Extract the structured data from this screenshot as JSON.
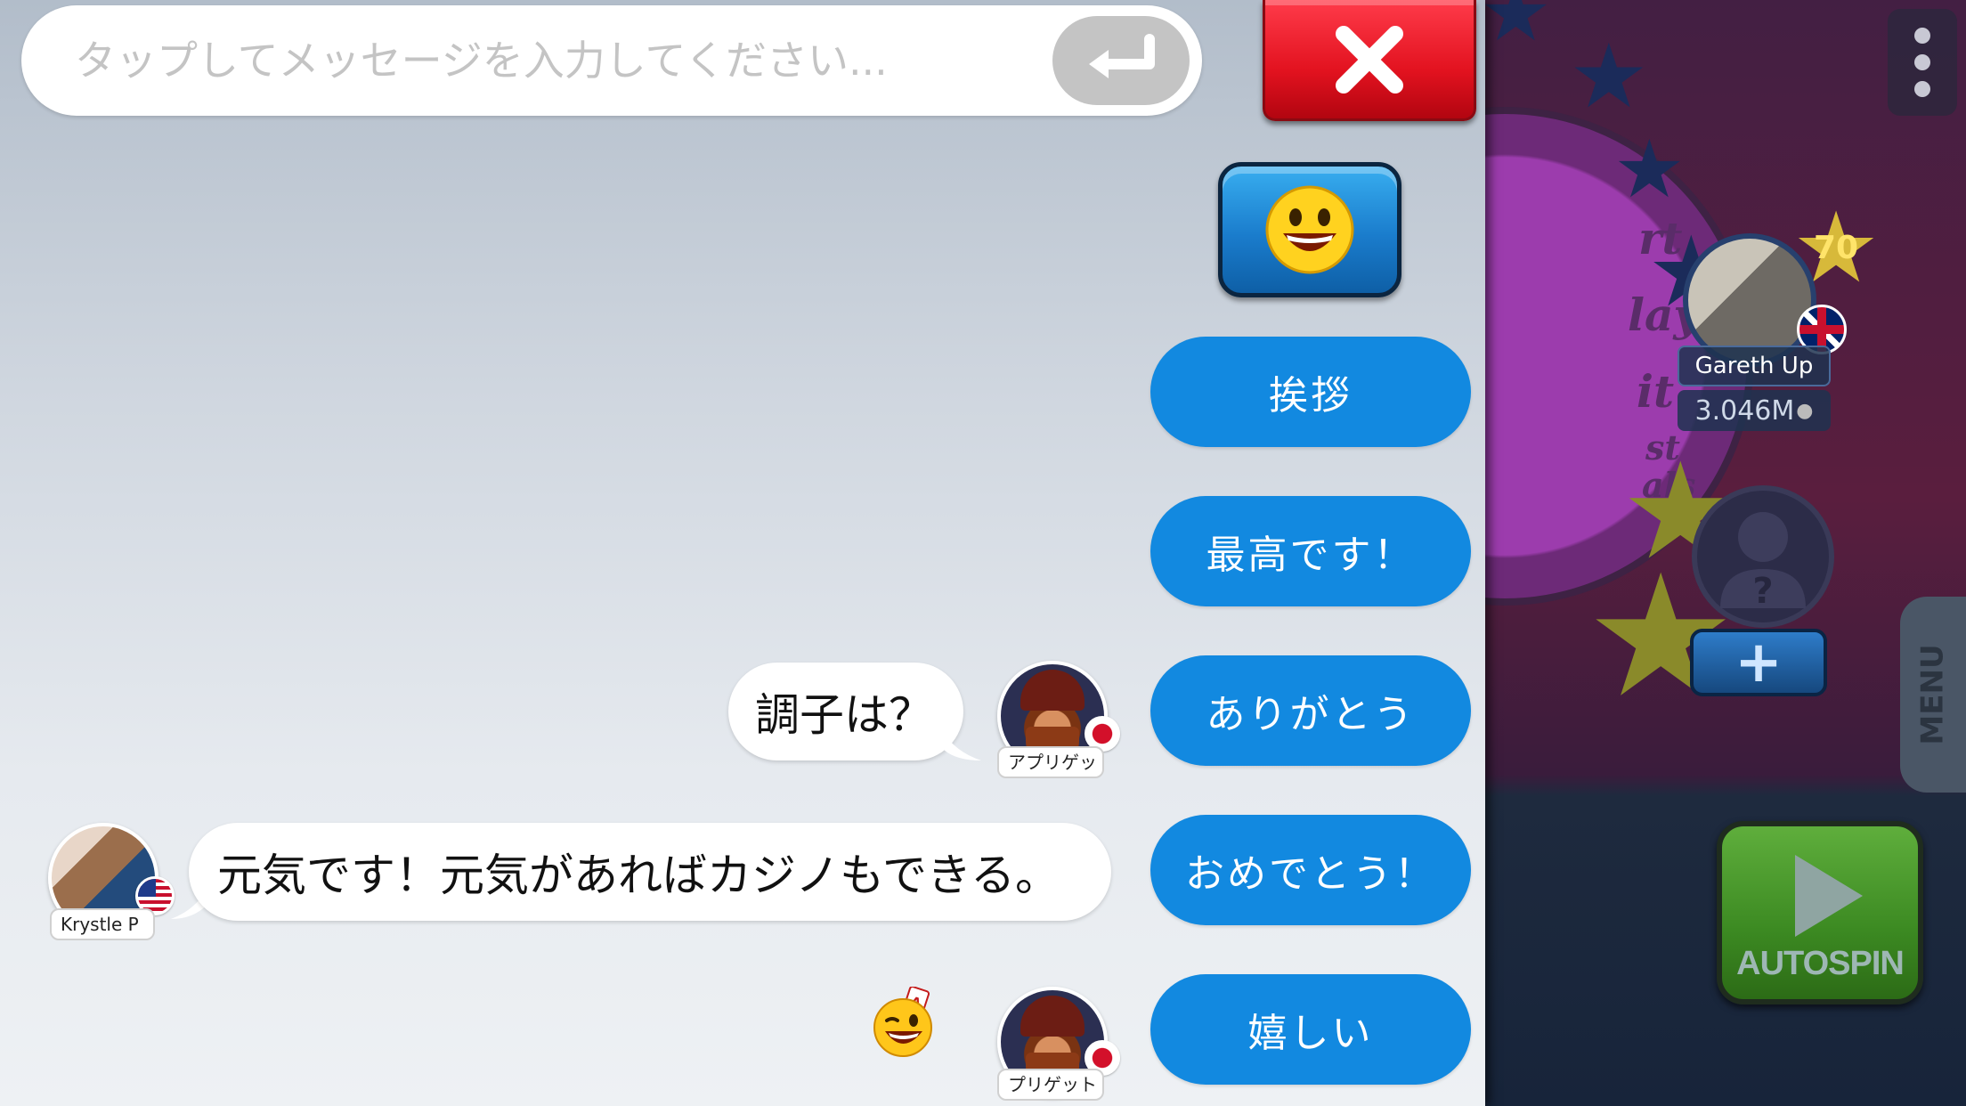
{
  "chat": {
    "input_placeholder": "タップしてメッセージを入力してください...",
    "input_value": "",
    "quick_replies": [
      "挨拶",
      "最高です！",
      "ありがとう",
      "おめでとう！",
      "嬉しい"
    ],
    "messages": [
      {
        "sender": "アプリゲッ",
        "text": "調子は？"
      },
      {
        "sender": "Krystle P",
        "text": "元気です！元気があればカジノもできる。"
      },
      {
        "sender": "プリゲット",
        "text": ""
      }
    ]
  },
  "game": {
    "player": {
      "name": "Gareth Up",
      "balance": "3.046M",
      "level": "70"
    },
    "wheel_labels": [
      "rt",
      "lay",
      "it",
      "st",
      "als"
    ],
    "menu_label": "MENU",
    "autospin_label": "AUTOSPIN"
  },
  "colors": {
    "quick_reply_blue": "#1289e0",
    "close_red": "#e2121f",
    "autospin_green": "#3c8a22"
  },
  "icons": {
    "send": "return-arrow-icon",
    "close": "x-icon",
    "emoji_toggle": "grinning-face-icon",
    "sent_emoji": "winking-face-with-ace-card-icon"
  }
}
